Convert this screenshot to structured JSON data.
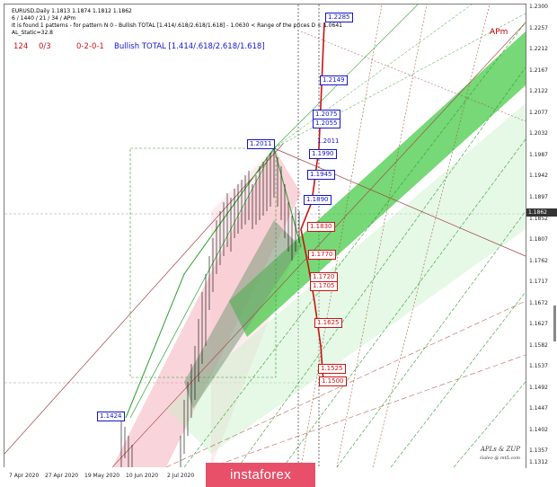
{
  "info": {
    "line1": "EURUSD,Daily  1.1813 1.1874 1.1812 1.1862",
    "line2": "6 / 1440 / 21 / 34 / APm",
    "line3": "It is found 1 patterns  -  for pattern N 0 - Bullish TOTAL [1.414/.618/2.618/1.618]  - 1.0630 < Range of the prices D < 1.0641",
    "line4": "AL_Static=32.8"
  },
  "status": {
    "count": "124",
    "ratio": "0/3",
    "code": "0-2-0-1",
    "pattern": "Bullish TOTAL [1.414/.618/2.618/1.618]"
  },
  "apm_label": "APm",
  "credit": {
    "line1": "APLs & ZUP",
    "line2": "Galeo @ mt5.com"
  },
  "banner": "instaforex",
  "price_axis": {
    "ticks": [
      "1.2300",
      "1.2257",
      "1.2212",
      "1.2167",
      "1.2122",
      "1.2077",
      "1.2032",
      "1.1987",
      "1.1942",
      "1.1897",
      "1.1852",
      "1.1807",
      "1.1762",
      "1.1717",
      "1.1672",
      "1.1627",
      "1.1582",
      "1.1537",
      "1.1492",
      "1.1447",
      "1.1402",
      "1.1357",
      "1.1312"
    ],
    "current": "1.1862"
  },
  "time_axis": [
    "7 Apr 2020",
    "27 Apr 2020",
    "19 May 2020",
    "10 Jun 2020",
    "2 Jul 2020"
  ],
  "levels_blue": [
    "1.2285",
    "1.2149",
    "1.2075",
    "1.2055",
    "1.1990",
    "1.1945",
    "1.1890"
  ],
  "levels_red": [
    "1.1830",
    "1.1770",
    "1.1720",
    "1.1705",
    "1.1625",
    "1.1525",
    "1.1500"
  ],
  "plain_blue": {
    "mid": "1.2011"
  },
  "box_left": {
    "top": "1.2011",
    "low": "1.1424"
  },
  "colors": {
    "blue": "#1414c8",
    "red": "#c81414",
    "green_band": "#3cc83c",
    "banner": "#e8506a"
  }
}
